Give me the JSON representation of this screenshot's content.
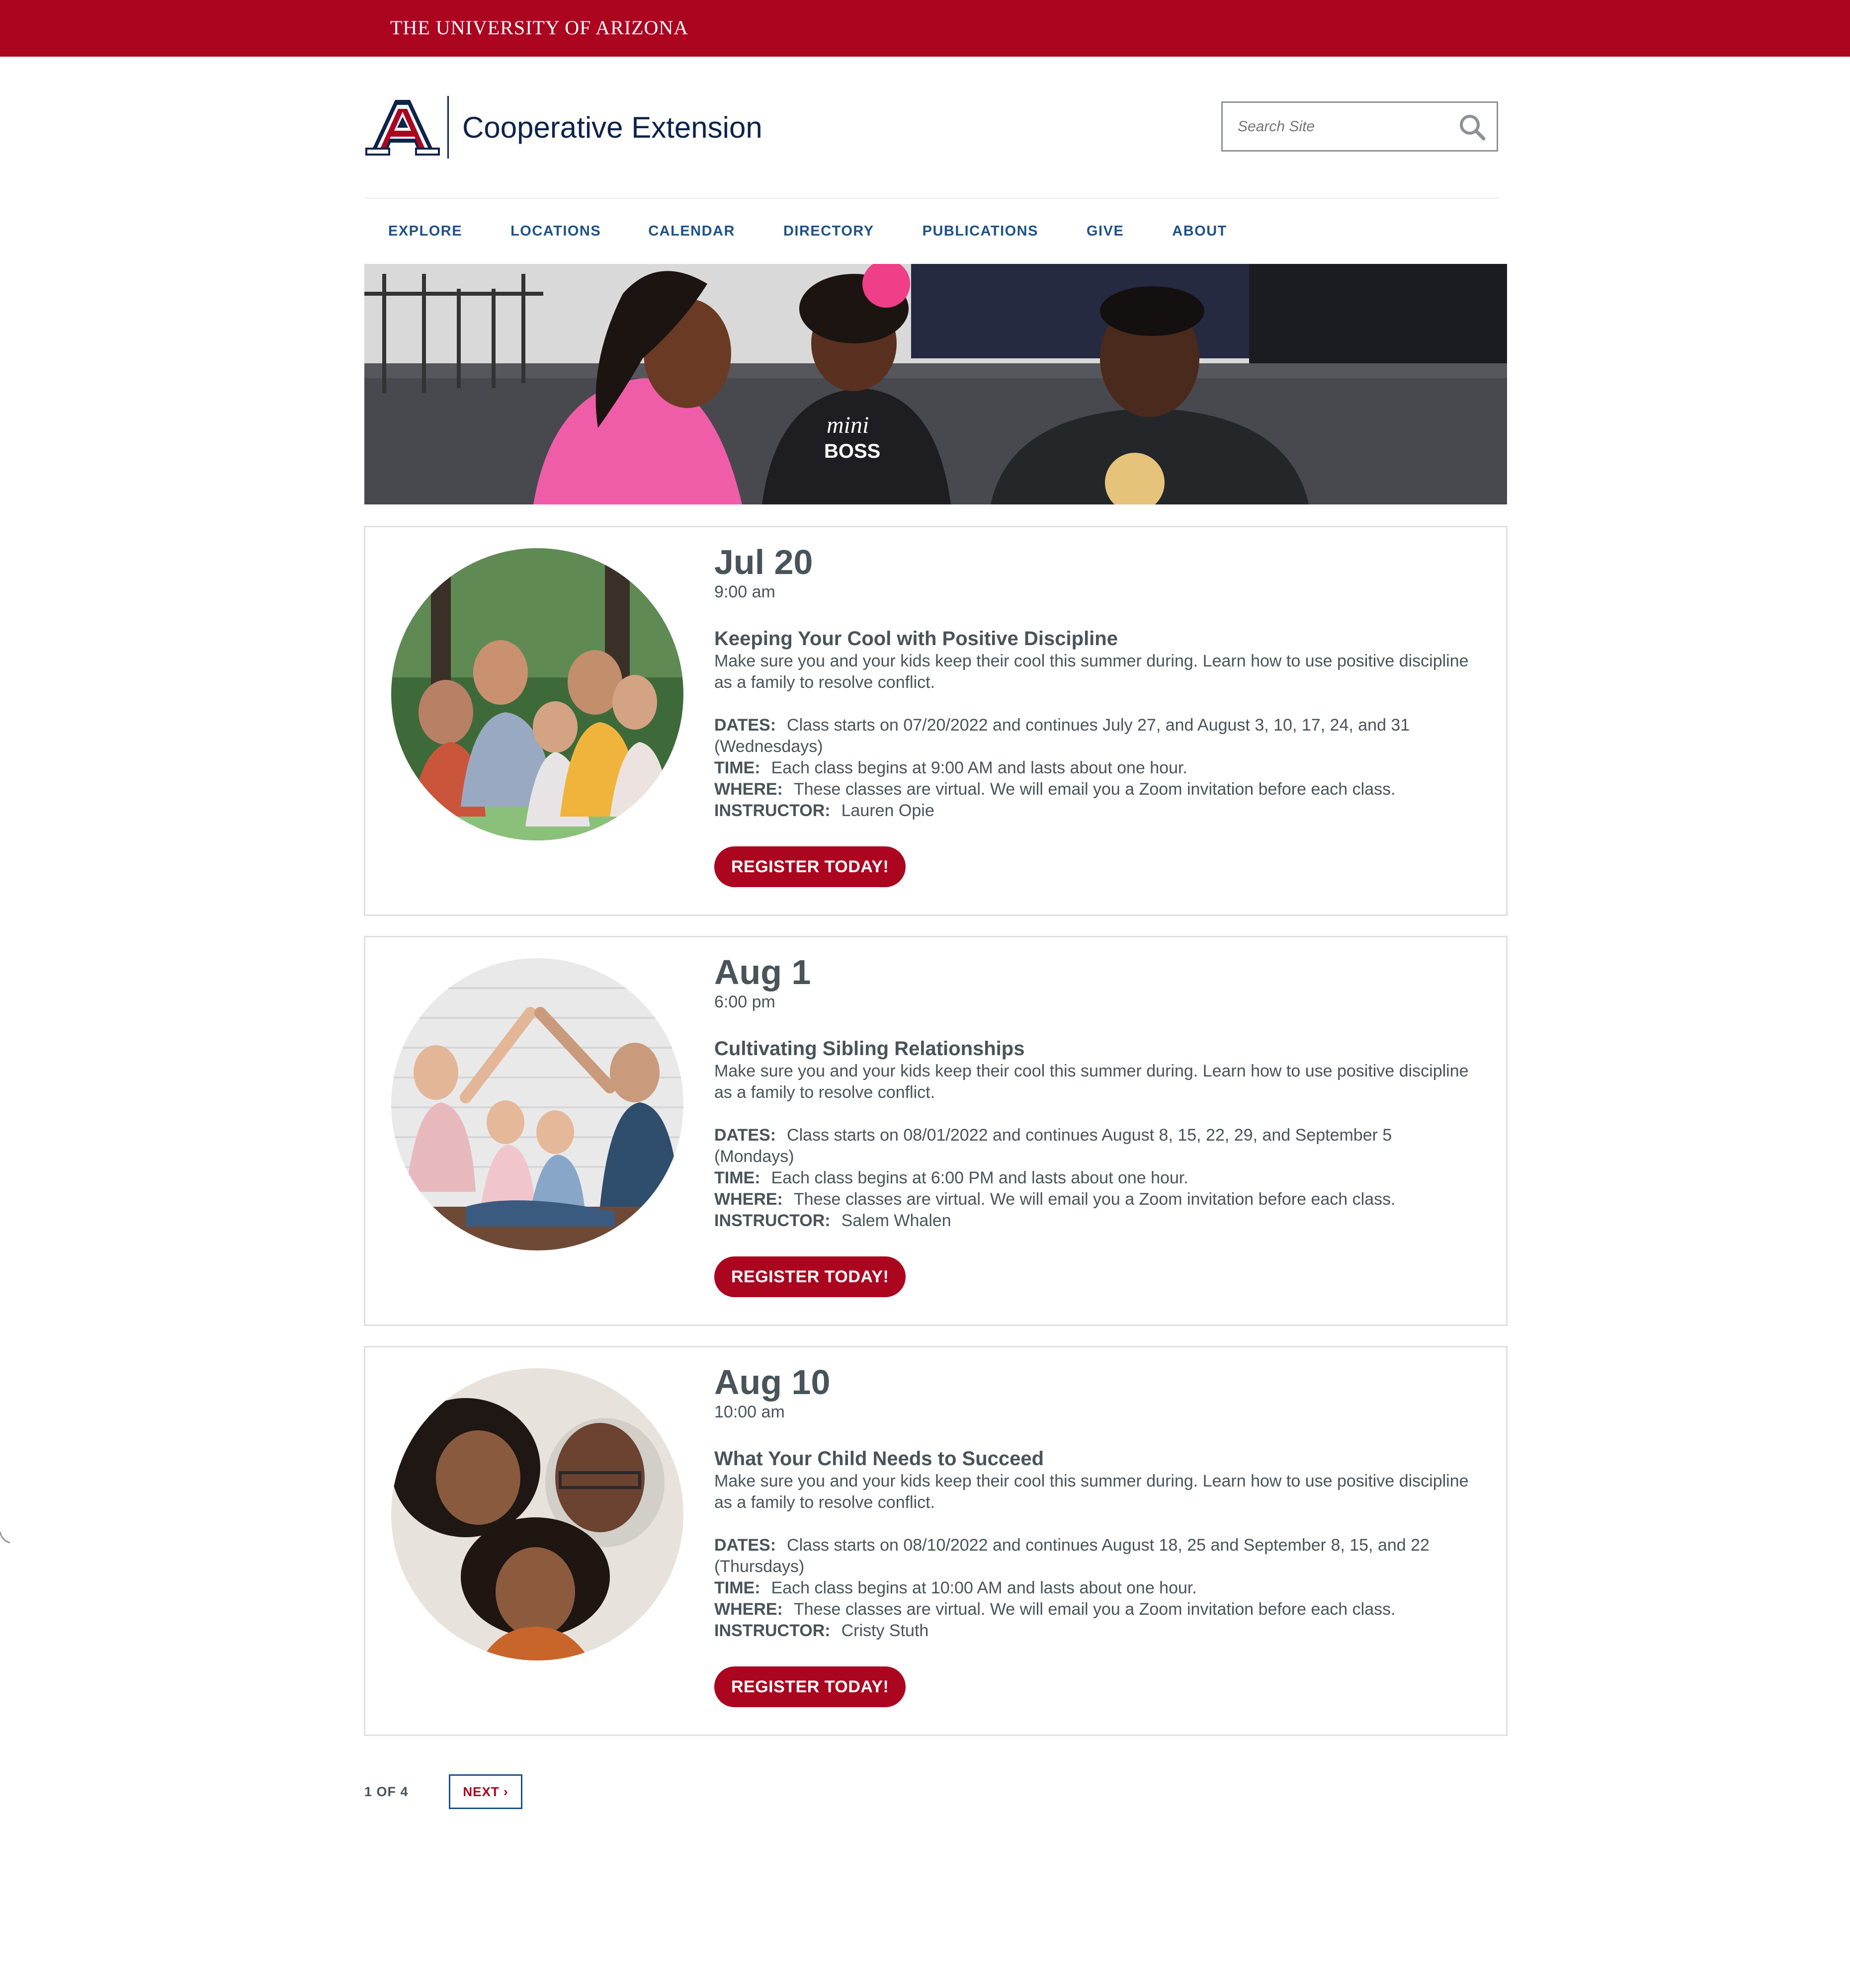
{
  "topbar": {
    "wordmark": "The University of Arizona"
  },
  "header": {
    "site_name": "Cooperative Extension",
    "search": {
      "placeholder": "Search Site",
      "value": ""
    }
  },
  "nav": {
    "items": [
      {
        "label": "EXPLORE"
      },
      {
        "label": "LOCATIONS"
      },
      {
        "label": "CALENDAR"
      },
      {
        "label": "DIRECTORY"
      },
      {
        "label": "PUBLICATIONS"
      },
      {
        "label": "GIVE"
      },
      {
        "label": "ABOUT"
      }
    ]
  },
  "hero": {
    "shirt_text_1": "mini",
    "shirt_text_2": "BOSS"
  },
  "events": [
    {
      "date": "Jul 20",
      "time": "9:00 am",
      "title": "Keeping Your Cool with Positive Discipline",
      "description": "Make sure you and your kids keep their cool this summer during. Learn how to use positive discipline as a family to resolve conflict.",
      "dates_label": "DATES:",
      "dates_value": "Class starts on 07/20/2022 and continues July 27, and August 3, 10, 17, 24, and 31 (Wednesdays)",
      "time_label": "TIME:",
      "time_value": "Each class begins at 9:00 AM and lasts about one hour.",
      "where_label": "WHERE:",
      "where_value": "These classes are virtual. We will email you a Zoom invitation before each class.",
      "instructor_label": "INSTRUCTOR:",
      "instructor_value": "Lauren Opie",
      "button": "REGISTER TODAY!"
    },
    {
      "date": "Aug 1",
      "time": "6:00 pm",
      "title": "Cultivating Sibling Relationships",
      "description": "Make sure you and your kids keep their cool this summer during. Learn how to use positive discipline as a family to resolve conflict.",
      "dates_label": "DATES:",
      "dates_value": "Class starts on 08/01/2022 and continues August 8, 15, 22, 29, and September 5 (Mondays)",
      "time_label": "TIME:",
      "time_value": "Each class begins at 6:00 PM and lasts about one hour.",
      "where_label": "WHERE:",
      "where_value": "These classes are virtual. We will email you a Zoom invitation before each class.",
      "instructor_label": "INSTRUCTOR:",
      "instructor_value": "Salem Whalen",
      "button": "REGISTER TODAY!"
    },
    {
      "date": "Aug 10",
      "time": "10:00 am",
      "title": "What Your Child Needs to Succeed",
      "description": "Make sure you and your kids keep their cool this summer during. Learn how to use positive discipline as a family to resolve conflict.",
      "dates_label": "DATES:",
      "dates_value": "Class starts on 08/10/2022 and continues August 18, 25 and September 8, 15, and 22 (Thursdays)",
      "time_label": "TIME:",
      "time_value": "Each class begins at 10:00 AM and lasts about one hour.",
      "where_label": "WHERE:",
      "where_value": "These classes are virtual. We will email you a Zoom invitation before each class.",
      "instructor_label": "INSTRUCTOR:",
      "instructor_value": "Cristy Stuth",
      "button": "REGISTER TODAY!"
    }
  ],
  "pager": {
    "status": "1 OF 4",
    "next": "NEXT ›"
  },
  "colors": {
    "brand_red": "#ab0520",
    "navy": "#0c234b",
    "link_blue": "#1e5288",
    "text": "#49535a"
  }
}
